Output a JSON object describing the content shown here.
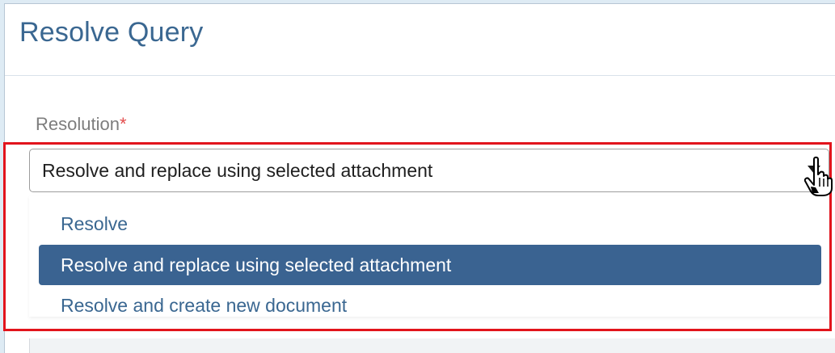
{
  "dialog": {
    "title": "Resolve Query"
  },
  "resolution": {
    "label": "Resolution",
    "required_marker": "*",
    "selected_value": "Resolve and replace using selected attachment",
    "options": [
      {
        "label": "Resolve",
        "selected": false
      },
      {
        "label": "Resolve and replace using selected attachment",
        "selected": true
      },
      {
        "label": "Resolve and create new document",
        "selected": false
      }
    ]
  },
  "colors": {
    "title": "#3a6791",
    "option_text": "#3a6791",
    "selected_bg": "#3a6391",
    "highlight": "#e2141c",
    "required": "#e34d4d"
  },
  "icons": {
    "dropdown": "chevron-down-icon",
    "cursor": "hand-pointer-icon"
  }
}
